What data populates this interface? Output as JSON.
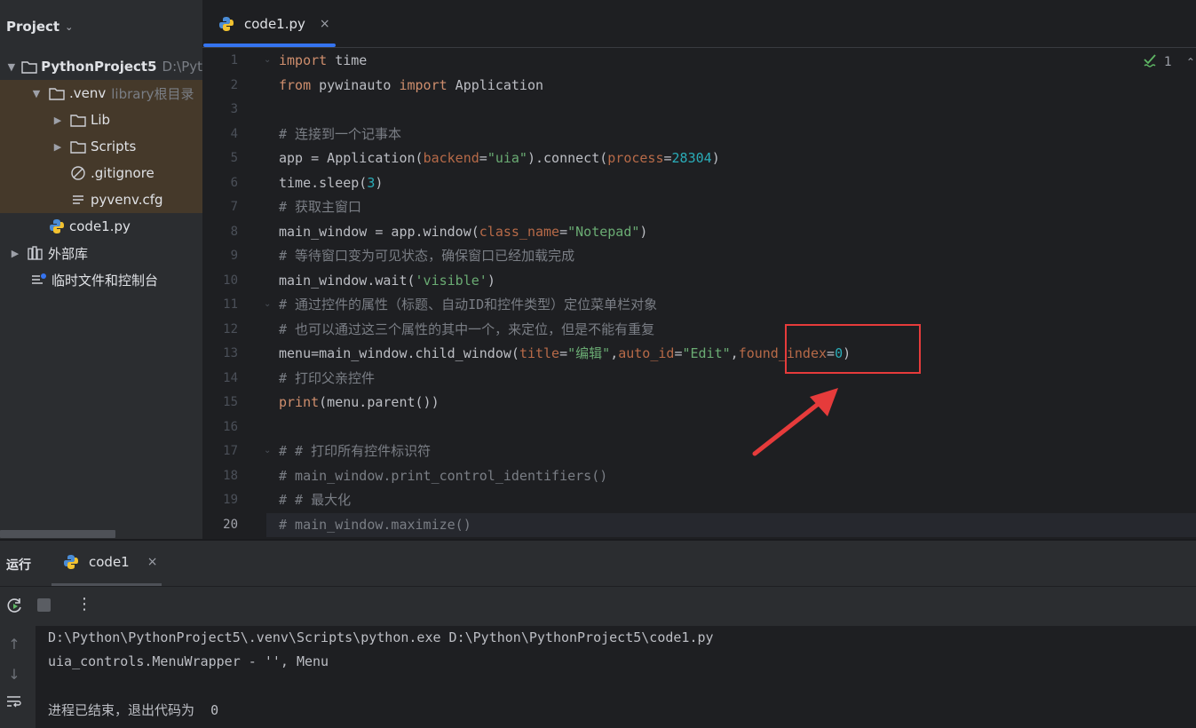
{
  "project_panel": {
    "title": "Project",
    "tree": [
      {
        "label": "PythonProject5",
        "hint": "D:\\Pyt",
        "icon": "folder-icon",
        "expanded": true
      },
      {
        "label": ".venv",
        "hint": "library根目录",
        "icon": "folder-icon",
        "expanded": true
      },
      {
        "label": "Lib",
        "icon": "folder-icon",
        "expanded": false
      },
      {
        "label": "Scripts",
        "icon": "folder-icon",
        "expanded": false
      },
      {
        "label": ".gitignore",
        "icon": "ignore-file-icon"
      },
      {
        "label": "pyvenv.cfg",
        "icon": "config-file-icon"
      },
      {
        "label": "code1.py",
        "icon": "python-file-icon"
      },
      {
        "label": "外部库",
        "icon": "library-icon",
        "expanded": false
      },
      {
        "label": "临时文件和控制台",
        "icon": "scratches-icon"
      }
    ]
  },
  "editor": {
    "tab_label": "code1.py",
    "tab_close": "×",
    "inspection_count": "1",
    "current_line": 20,
    "line_numbers": [
      "1",
      "2",
      "3",
      "4",
      "5",
      "6",
      "7",
      "8",
      "9",
      "10",
      "11",
      "12",
      "13",
      "14",
      "15",
      "16",
      "17",
      "18",
      "19",
      "20"
    ],
    "lines": {
      "l1": {
        "a": "import",
        "b": " time"
      },
      "l2": {
        "a": "from",
        "b": " pywinauto ",
        "c": "import",
        "d": " Application"
      },
      "l4": "# 连接到一个记事本",
      "l5": {
        "a": "app = Application(",
        "b": "backend",
        "c": "=",
        "d": "\"uia\"",
        "e": ").connect(",
        "f": "process",
        "g": "=",
        "h": "28304",
        "i": ")"
      },
      "l6": {
        "a": "time.sleep(",
        "b": "3",
        "c": ")"
      },
      "l7": "# 获取主窗口",
      "l8": {
        "a": "main_window = app.window(",
        "b": "class_name",
        "c": "=",
        "d": "\"Notepad\"",
        "e": ")"
      },
      "l9": "# 等待窗口变为可见状态，确保窗口已经加载完成",
      "l10": {
        "a": "main_window.wait(",
        "b": "'visible'",
        "c": ")"
      },
      "l11": "# 通过控件的属性（标题、自动ID和控件类型）定位菜单栏对象",
      "l12": "# 也可以通过这三个属性的其中一个，来定位，但是不能有重复",
      "l13": {
        "a": "menu=main_window.child_window(",
        "b": "title",
        "c": "=",
        "d": "\"编辑\"",
        "e": ",",
        "f": "auto_id",
        "g": "=",
        "h": "\"Edit\"",
        "i": ",",
        "j": "found_index",
        "k": "=",
        "l": "0",
        "m": ")"
      },
      "l14": "# 打印父亲控件",
      "l15": {
        "a": "print",
        "b": "(menu.parent())"
      },
      "l17": "# # 打印所有控件标识符",
      "l18": "# main_window.print_control_identifiers()",
      "l19": "# # 最大化",
      "l20": "# main_window.maximize()"
    }
  },
  "run_panel": {
    "title": "运行",
    "tab_label": "code1",
    "tab_close": "×",
    "output": [
      "D:\\Python\\PythonProject5\\.venv\\Scripts\\python.exe D:\\Python\\PythonProject5\\code1.py",
      "uia_controls.MenuWrapper - '', Menu",
      "",
      "进程已结束，退出代码为  0"
    ]
  },
  "colors": {
    "accent": "#3574f0",
    "annotation": "#e63b3b",
    "keyword": "#cf8e6d",
    "string": "#6aab73",
    "number": "#2aacb8",
    "comment": "#7a7e85"
  }
}
